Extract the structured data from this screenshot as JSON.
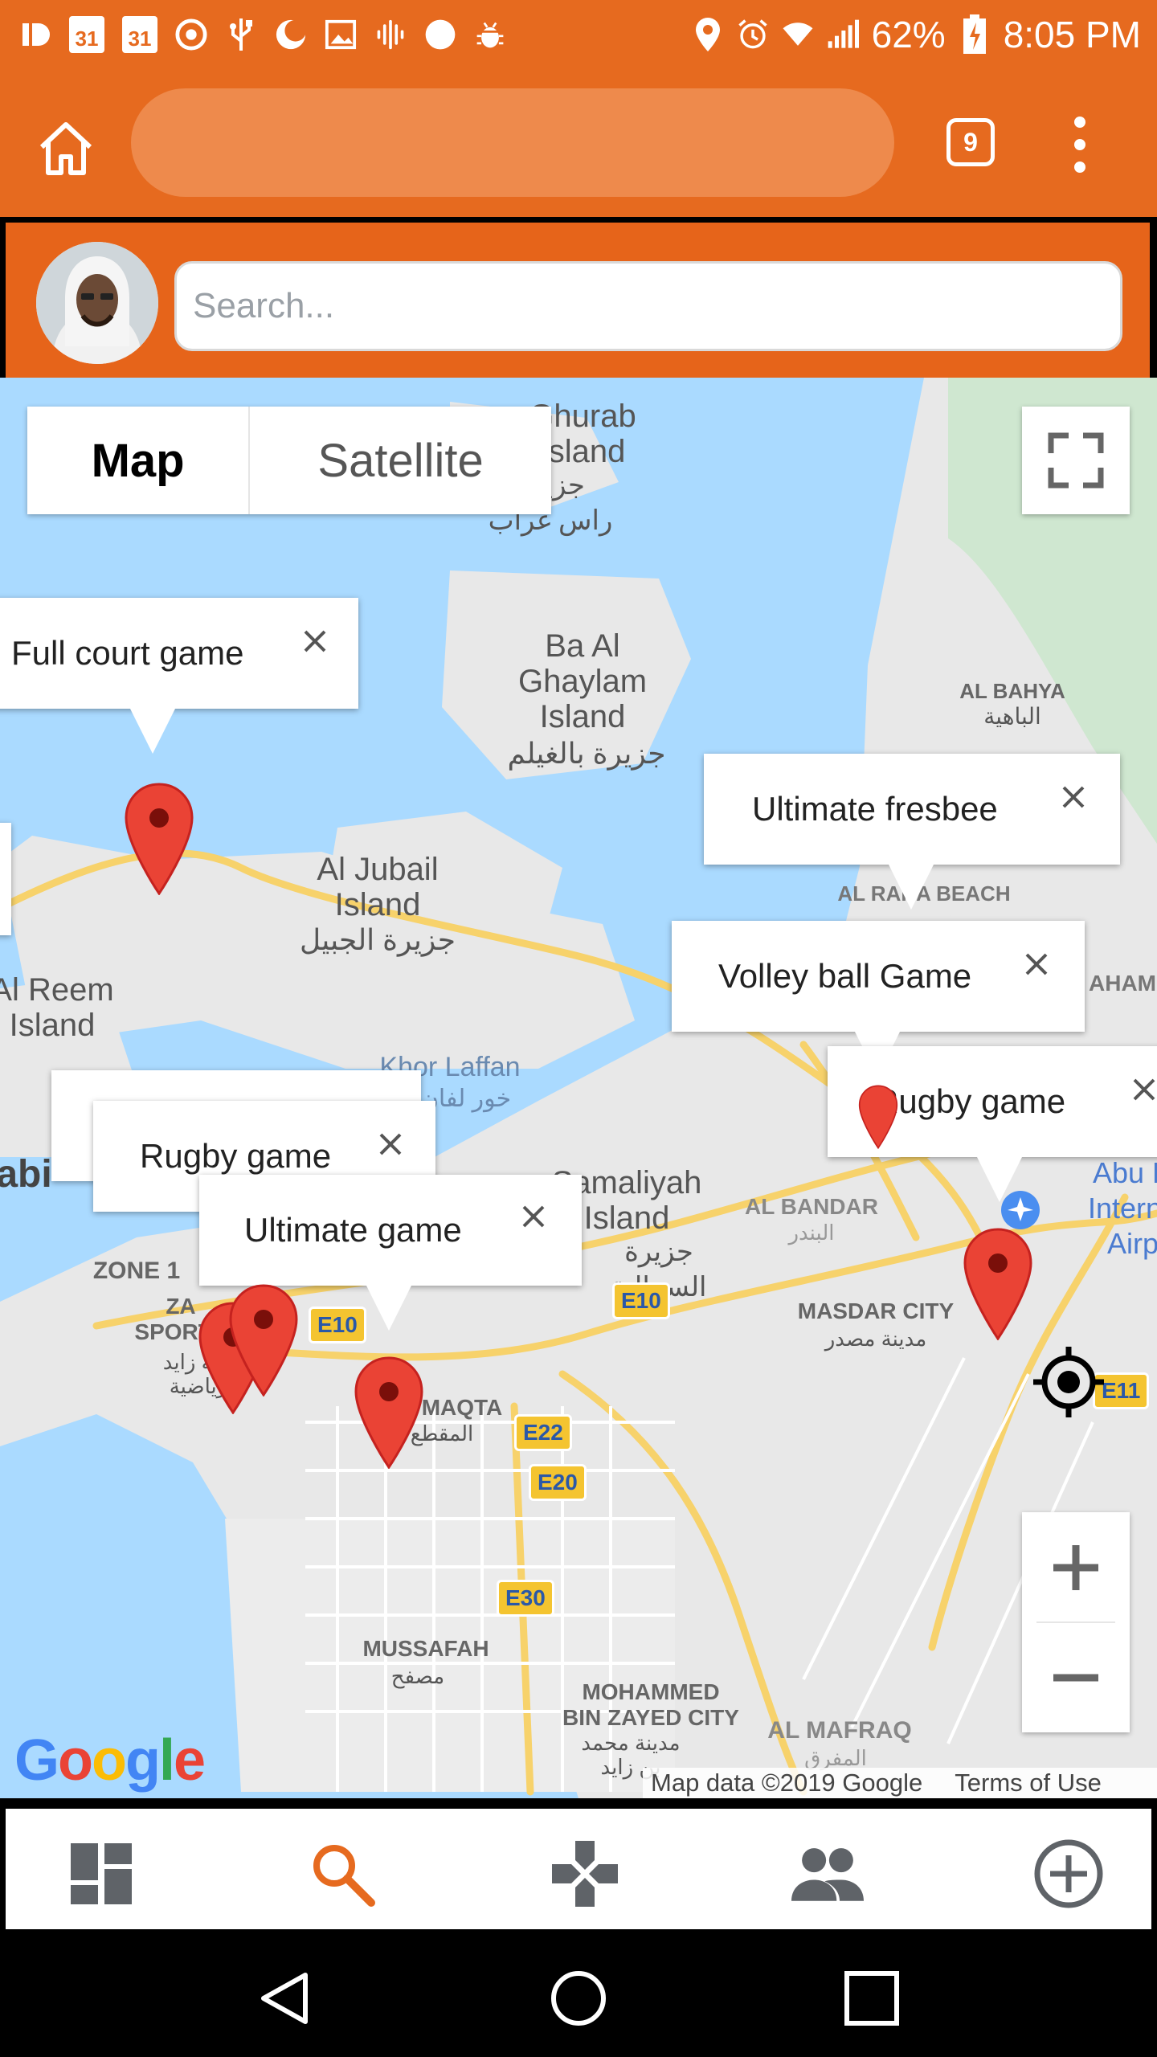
{
  "status_bar": {
    "calendar_day_1": "31",
    "calendar_day_2": "31",
    "battery": "62%",
    "time": "8:05 PM"
  },
  "browser": {
    "tab_count": "9"
  },
  "app_header": {
    "search": {
      "placeholder": "Search..."
    }
  },
  "map": {
    "type_controls": {
      "map_label": "Map",
      "satellite_label": "Satellite",
      "selected": "Map"
    },
    "labels": [
      {
        "id": "ghurab",
        "text": "Ghurab\nIsland"
      },
      {
        "id": "ghurab_ar",
        "text": "جزيرة\nراس غراب"
      },
      {
        "id": "baalghaylam",
        "text": "Ba Al\nGhaylam\nIsland"
      },
      {
        "id": "baalghaylam_ar",
        "text": "جزيرة بالغيلم"
      },
      {
        "id": "albahya",
        "text": "AL BAHYA"
      },
      {
        "id": "albahya_ar",
        "text": "الباهية"
      },
      {
        "id": "aljubail",
        "text": "Al Jubail\nIsland"
      },
      {
        "id": "aljubail_ar",
        "text": "جزيرة الجبيل"
      },
      {
        "id": "alreem",
        "text": "Al Reem\nIsland"
      },
      {
        "id": "khorlaffan",
        "text": "Khor Laffan"
      },
      {
        "id": "khorlaffan_ar",
        "text": "خور لفان"
      },
      {
        "id": "abu",
        "text": "abi"
      },
      {
        "id": "zone1",
        "text": "ZONE 1"
      },
      {
        "id": "zasports",
        "text": "ZA\nSPORTS"
      },
      {
        "id": "zasports_ar",
        "text": "مدينة زايد\nالرياضية"
      },
      {
        "id": "samaliyah",
        "text": "Samaliyah\nIsland"
      },
      {
        "id": "samaliyah_ar",
        "text": "جزيرة السمالية"
      },
      {
        "id": "albandar",
        "text": "AL BANDAR"
      },
      {
        "id": "albandar_ar",
        "text": "البندر"
      },
      {
        "id": "masdar",
        "text": "MASDAR CITY"
      },
      {
        "id": "masdar_ar",
        "text": "مدينة مصدر"
      },
      {
        "id": "almaqta",
        "text": "MAQTA"
      },
      {
        "id": "almaqta_ar",
        "text": "المقطع"
      },
      {
        "id": "alraha",
        "text": "AL RAHA BEACH"
      },
      {
        "id": "alshahama",
        "text": "AHAM"
      },
      {
        "id": "abudhabiairport",
        "text": "Abu D\nInterna\nAirp"
      },
      {
        "id": "mussafah",
        "text": "MUSSAFAH"
      },
      {
        "id": "mussafah_ar",
        "text": "مصفح"
      },
      {
        "id": "mbz",
        "text": "MOHAMMED\nBIN ZAYED CITY"
      },
      {
        "id": "mbz_ar",
        "text": "مدينة محمد\nبن زايد"
      },
      {
        "id": "almafraq",
        "text": "AL MAFRAQ"
      },
      {
        "id": "almafraq_ar",
        "text": "المفرق"
      }
    ],
    "road_badges": [
      "E10",
      "E10",
      "E22",
      "E20",
      "E30",
      "E11"
    ],
    "info_windows": [
      {
        "id": "full-court",
        "title": "Full court game"
      },
      {
        "id": "ultimate-fresbee",
        "title": "Ultimate fresbee"
      },
      {
        "id": "volleyball",
        "title": "Volley ball Game"
      },
      {
        "id": "rugby-east",
        "title": "Rugby game"
      },
      {
        "id": "rugby-west",
        "title": "Rugby game"
      },
      {
        "id": "ultimate-game",
        "title": "Ultimate game"
      }
    ],
    "google_logo": "Google",
    "attribution": {
      "data": "Map data ©2019 Google",
      "terms": "Terms of Use"
    }
  },
  "bottom_nav": {
    "items": [
      "dashboard",
      "search",
      "games",
      "people",
      "add"
    ],
    "active": "search",
    "active_color": "#e66a1f",
    "inactive_color": "#5f6368"
  },
  "colors": {
    "brand": "#e66a1f",
    "map_water": "#aadaff",
    "map_land": "#e8e8e8",
    "pin": "#ea4335",
    "road_yellow": "#f7d26b"
  }
}
